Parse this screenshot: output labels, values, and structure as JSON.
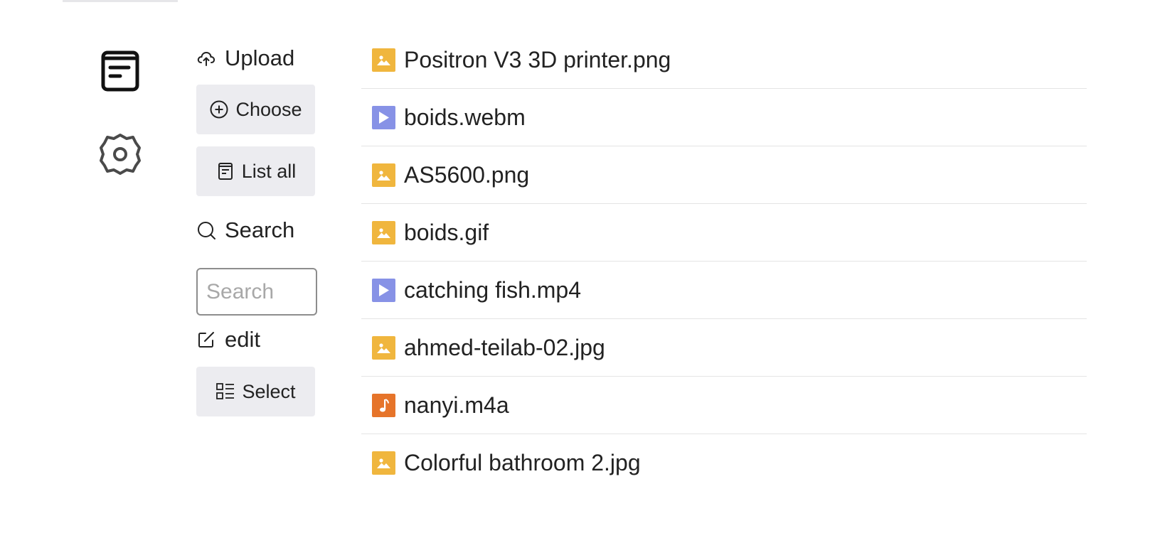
{
  "rail": {
    "items": [
      {
        "icon": "file-list-icon"
      },
      {
        "icon": "gear-icon"
      }
    ]
  },
  "panel": {
    "upload_label": "Upload",
    "choose_label": "Choose",
    "list_all_label": "List all",
    "search_label": "Search",
    "search_placeholder": "Search",
    "search_value": "",
    "edit_label": "edit",
    "select_label": "Select"
  },
  "files": [
    {
      "name": "Positron V3 3D printer.png",
      "type": "image"
    },
    {
      "name": "boids.webm",
      "type": "video"
    },
    {
      "name": "AS5600.png",
      "type": "image"
    },
    {
      "name": "boids.gif",
      "type": "image"
    },
    {
      "name": "catching fish.mp4",
      "type": "video"
    },
    {
      "name": "ahmed-teilab-02.jpg",
      "type": "image"
    },
    {
      "name": "nanyi.m4a",
      "type": "audio"
    },
    {
      "name": "Colorful bathroom 2.jpg",
      "type": "image"
    }
  ],
  "colors": {
    "image": "#f0b63e",
    "video": "#8792e6",
    "audio": "#e6742a",
    "button_bg": "#ececf0"
  }
}
